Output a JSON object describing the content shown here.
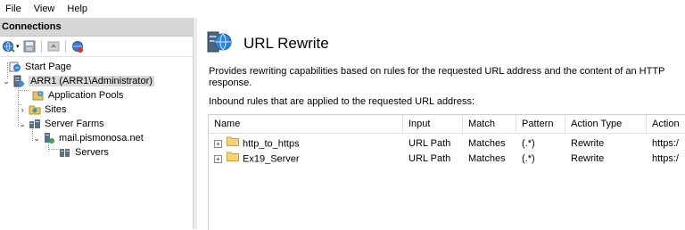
{
  "menu": {
    "file": "File",
    "view": "View",
    "help": "Help"
  },
  "connections": {
    "header": "Connections",
    "tree": {
      "start_page": "Start Page",
      "server": "ARR1 (ARR1\\Administrator)",
      "app_pools": "Application Pools",
      "sites": "Sites",
      "server_farms": "Server Farms",
      "farm": "mail.pismonosa.net",
      "servers": "Servers"
    }
  },
  "main": {
    "title": "URL Rewrite",
    "description": "Provides rewriting capabilities based on rules for the requested URL address and the content of an HTTP response.",
    "inbound_label": "Inbound rules that are applied to the requested URL address:",
    "columns": {
      "name": "Name",
      "input": "Input",
      "match": "Match",
      "pattern": "Pattern",
      "action_type": "Action Type",
      "action": "Action"
    },
    "rules": [
      {
        "name": "http_to_https",
        "input": "URL Path",
        "match": "Matches",
        "pattern": "(.*)",
        "action_type": "Rewrite",
        "action": "https:/"
      },
      {
        "name": "Ex19_Server",
        "input": "URL Path",
        "match": "Matches",
        "pattern": "(.*)",
        "action_type": "Rewrite",
        "action": "https:/"
      }
    ]
  }
}
